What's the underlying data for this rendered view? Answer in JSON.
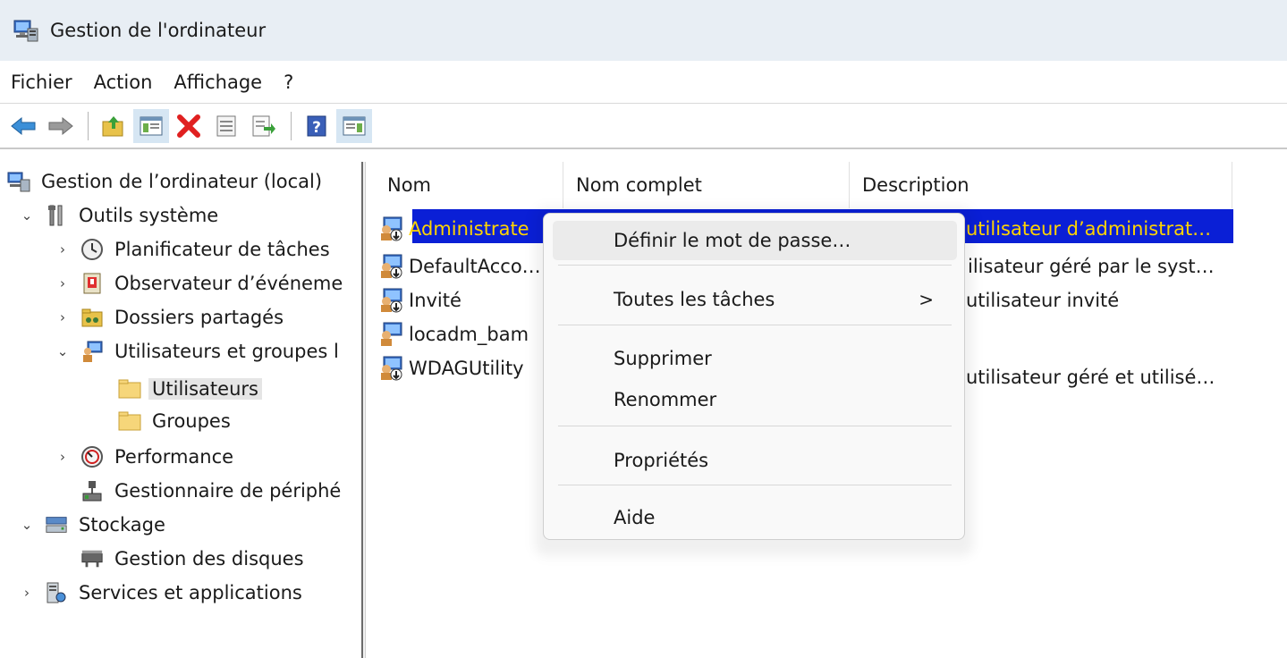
{
  "window": {
    "title": "Gestion de l'ordinateur",
    "icon": "computer-management-icon"
  },
  "menu": [
    "Fichier",
    "Action",
    "Affichage",
    "?"
  ],
  "toolbar": {
    "buttons": [
      "back-arrow-icon",
      "forward-arrow-icon",
      "up-folder-icon",
      "show-hide-console-tree-icon",
      "delete-icon",
      "properties-icon",
      "export-list-icon",
      "help-icon",
      "show-hide-action-pane-icon"
    ]
  },
  "tree": [
    {
      "label": "Gestion de l’ordinateur (local)",
      "icon": "computer-management-icon",
      "expander": ""
    },
    {
      "label": "Outils système",
      "icon": "tools-icon",
      "expander": "⌄"
    },
    {
      "label": "Planificateur de tâches",
      "icon": "clock-icon",
      "expander": "›"
    },
    {
      "label": "Observateur d’événeme",
      "icon": "event-viewer-icon",
      "expander": "›"
    },
    {
      "label": "Dossiers partagés",
      "icon": "shared-folders-icon",
      "expander": "›"
    },
    {
      "label": "Utilisateurs et groupes l",
      "icon": "users-groups-icon",
      "expander": "⌄"
    },
    {
      "label": "Utilisateurs",
      "icon": "folder-icon",
      "expander": ""
    },
    {
      "label": "Groupes",
      "icon": "folder-icon",
      "expander": ""
    },
    {
      "label": "Performance",
      "icon": "performance-icon",
      "expander": "›"
    },
    {
      "label": "Gestionnaire de périphé",
      "icon": "device-manager-icon",
      "expander": ""
    },
    {
      "label": "Stockage",
      "icon": "storage-icon",
      "expander": "⌄"
    },
    {
      "label": "Gestion des disques",
      "icon": "disk-management-icon",
      "expander": ""
    },
    {
      "label": "Services et applications",
      "icon": "services-icon",
      "expander": "›"
    }
  ],
  "columns": [
    "Nom",
    "Nom complet",
    "Description"
  ],
  "users": [
    {
      "name": "Administrate",
      "description": "utilisateur d’administrat…",
      "icon": "user-disabled-icon"
    },
    {
      "name": "DefaultAcco…",
      "description": "ilisateur géré par le syst…",
      "icon": "user-disabled-icon"
    },
    {
      "name": "Invité",
      "description": "utilisateur invité",
      "icon": "user-disabled-icon"
    },
    {
      "name": "locadm_bam",
      "description": "",
      "icon": "user-icon"
    },
    {
      "name": "WDAGUtility",
      "description": "utilisateur géré et utilisé…",
      "icon": "user-disabled-icon"
    }
  ],
  "context_menu": {
    "set_password": "Définir le mot de passe…",
    "all_tasks": "Toutes les tâches",
    "all_tasks_arrow": ">",
    "delete": "Supprimer",
    "rename": "Renommer",
    "properties": "Propriétés",
    "help": "Aide"
  },
  "colors": {
    "selection": "#0a1fd6",
    "selection_text": "#ffd400",
    "titlebar": "#e8eef4"
  }
}
